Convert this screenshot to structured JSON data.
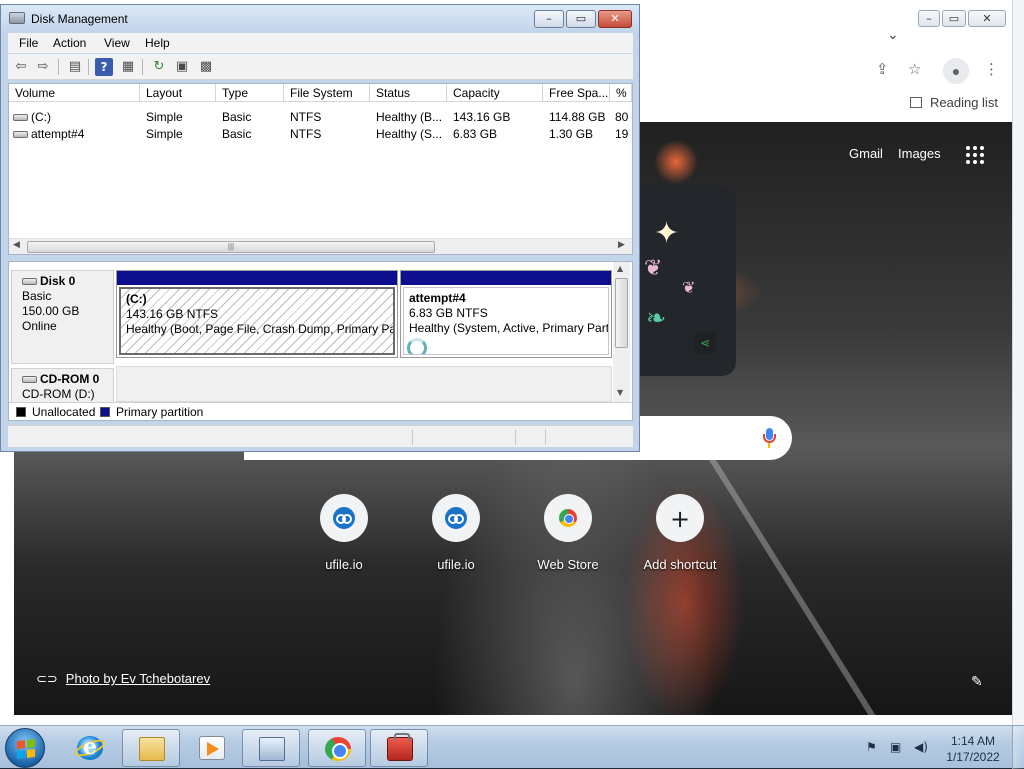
{
  "chrome": {
    "bookmarks": {
      "reading_list": "Reading list"
    },
    "ntp": {
      "gmail": "Gmail",
      "images": "Images",
      "shortcuts": [
        {
          "label": "ufile.io",
          "icon": "ufile-icon"
        },
        {
          "label": "ufile.io",
          "icon": "ufile-icon"
        },
        {
          "label": "Web Store",
          "icon": "webstore-icon"
        },
        {
          "label": "Add shortcut",
          "icon": "plus-icon"
        }
      ],
      "photo_credit": "Photo by Ev Tchebotarev"
    }
  },
  "disk_management": {
    "title": "Disk Management",
    "menu": [
      "File",
      "Action",
      "View",
      "Help"
    ],
    "columns": [
      "Volume",
      "Layout",
      "Type",
      "File System",
      "Status",
      "Capacity",
      "Free Spa...",
      "% F"
    ],
    "volumes": [
      {
        "volume": "(C:)",
        "layout": "Simple",
        "type": "Basic",
        "fs": "NTFS",
        "status": "Healthy (B...",
        "capacity": "143.16 GB",
        "free": "114.88 GB",
        "pct": "80"
      },
      {
        "volume": "attempt#4",
        "layout": "Simple",
        "type": "Basic",
        "fs": "NTFS",
        "status": "Healthy (S...",
        "capacity": "6.83 GB",
        "free": "1.30 GB",
        "pct": "19"
      }
    ],
    "disks": [
      {
        "name": "Disk 0",
        "type": "Basic",
        "size": "150.00 GB",
        "state": "Online"
      },
      {
        "name": "CD-ROM 0",
        "drive": "CD-ROM (D:)"
      }
    ],
    "partitions": [
      {
        "name": "(C:)",
        "size": "143.16 GB NTFS",
        "status": "Healthy (Boot, Page File, Crash Dump, Primary Part"
      },
      {
        "name": "attempt#4",
        "size": "6.83 GB NTFS",
        "status": "Healthy (System, Active, Primary Part"
      }
    ],
    "legend": [
      {
        "label": "Unallocated",
        "color": "#000000"
      },
      {
        "label": "Primary partition",
        "color": "#0e0f8d"
      }
    ]
  },
  "taskbar": {
    "clock": {
      "time": "1:14 AM",
      "date": "1/17/2022"
    }
  }
}
